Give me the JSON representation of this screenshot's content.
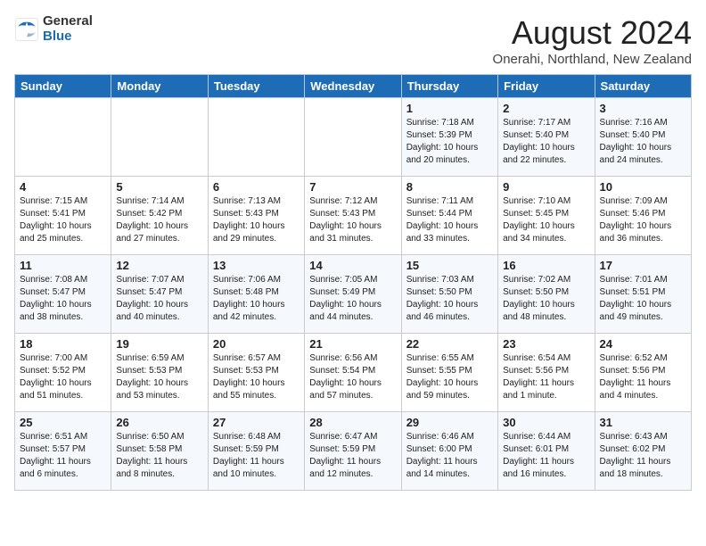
{
  "logo": {
    "general": "General",
    "blue": "Blue"
  },
  "title": "August 2024",
  "subtitle": "Onerahi, Northland, New Zealand",
  "days_header": [
    "Sunday",
    "Monday",
    "Tuesday",
    "Wednesday",
    "Thursday",
    "Friday",
    "Saturday"
  ],
  "weeks": [
    [
      {
        "day": "",
        "info": ""
      },
      {
        "day": "",
        "info": ""
      },
      {
        "day": "",
        "info": ""
      },
      {
        "day": "",
        "info": ""
      },
      {
        "day": "1",
        "info": "Sunrise: 7:18 AM\nSunset: 5:39 PM\nDaylight: 10 hours\nand 20 minutes."
      },
      {
        "day": "2",
        "info": "Sunrise: 7:17 AM\nSunset: 5:40 PM\nDaylight: 10 hours\nand 22 minutes."
      },
      {
        "day": "3",
        "info": "Sunrise: 7:16 AM\nSunset: 5:40 PM\nDaylight: 10 hours\nand 24 minutes."
      }
    ],
    [
      {
        "day": "4",
        "info": "Sunrise: 7:15 AM\nSunset: 5:41 PM\nDaylight: 10 hours\nand 25 minutes."
      },
      {
        "day": "5",
        "info": "Sunrise: 7:14 AM\nSunset: 5:42 PM\nDaylight: 10 hours\nand 27 minutes."
      },
      {
        "day": "6",
        "info": "Sunrise: 7:13 AM\nSunset: 5:43 PM\nDaylight: 10 hours\nand 29 minutes."
      },
      {
        "day": "7",
        "info": "Sunrise: 7:12 AM\nSunset: 5:43 PM\nDaylight: 10 hours\nand 31 minutes."
      },
      {
        "day": "8",
        "info": "Sunrise: 7:11 AM\nSunset: 5:44 PM\nDaylight: 10 hours\nand 33 minutes."
      },
      {
        "day": "9",
        "info": "Sunrise: 7:10 AM\nSunset: 5:45 PM\nDaylight: 10 hours\nand 34 minutes."
      },
      {
        "day": "10",
        "info": "Sunrise: 7:09 AM\nSunset: 5:46 PM\nDaylight: 10 hours\nand 36 minutes."
      }
    ],
    [
      {
        "day": "11",
        "info": "Sunrise: 7:08 AM\nSunset: 5:47 PM\nDaylight: 10 hours\nand 38 minutes."
      },
      {
        "day": "12",
        "info": "Sunrise: 7:07 AM\nSunset: 5:47 PM\nDaylight: 10 hours\nand 40 minutes."
      },
      {
        "day": "13",
        "info": "Sunrise: 7:06 AM\nSunset: 5:48 PM\nDaylight: 10 hours\nand 42 minutes."
      },
      {
        "day": "14",
        "info": "Sunrise: 7:05 AM\nSunset: 5:49 PM\nDaylight: 10 hours\nand 44 minutes."
      },
      {
        "day": "15",
        "info": "Sunrise: 7:03 AM\nSunset: 5:50 PM\nDaylight: 10 hours\nand 46 minutes."
      },
      {
        "day": "16",
        "info": "Sunrise: 7:02 AM\nSunset: 5:50 PM\nDaylight: 10 hours\nand 48 minutes."
      },
      {
        "day": "17",
        "info": "Sunrise: 7:01 AM\nSunset: 5:51 PM\nDaylight: 10 hours\nand 49 minutes."
      }
    ],
    [
      {
        "day": "18",
        "info": "Sunrise: 7:00 AM\nSunset: 5:52 PM\nDaylight: 10 hours\nand 51 minutes."
      },
      {
        "day": "19",
        "info": "Sunrise: 6:59 AM\nSunset: 5:53 PM\nDaylight: 10 hours\nand 53 minutes."
      },
      {
        "day": "20",
        "info": "Sunrise: 6:57 AM\nSunset: 5:53 PM\nDaylight: 10 hours\nand 55 minutes."
      },
      {
        "day": "21",
        "info": "Sunrise: 6:56 AM\nSunset: 5:54 PM\nDaylight: 10 hours\nand 57 minutes."
      },
      {
        "day": "22",
        "info": "Sunrise: 6:55 AM\nSunset: 5:55 PM\nDaylight: 10 hours\nand 59 minutes."
      },
      {
        "day": "23",
        "info": "Sunrise: 6:54 AM\nSunset: 5:56 PM\nDaylight: 11 hours\nand 1 minute."
      },
      {
        "day": "24",
        "info": "Sunrise: 6:52 AM\nSunset: 5:56 PM\nDaylight: 11 hours\nand 4 minutes."
      }
    ],
    [
      {
        "day": "25",
        "info": "Sunrise: 6:51 AM\nSunset: 5:57 PM\nDaylight: 11 hours\nand 6 minutes."
      },
      {
        "day": "26",
        "info": "Sunrise: 6:50 AM\nSunset: 5:58 PM\nDaylight: 11 hours\nand 8 minutes."
      },
      {
        "day": "27",
        "info": "Sunrise: 6:48 AM\nSunset: 5:59 PM\nDaylight: 11 hours\nand 10 minutes."
      },
      {
        "day": "28",
        "info": "Sunrise: 6:47 AM\nSunset: 5:59 PM\nDaylight: 11 hours\nand 12 minutes."
      },
      {
        "day": "29",
        "info": "Sunrise: 6:46 AM\nSunset: 6:00 PM\nDaylight: 11 hours\nand 14 minutes."
      },
      {
        "day": "30",
        "info": "Sunrise: 6:44 AM\nSunset: 6:01 PM\nDaylight: 11 hours\nand 16 minutes."
      },
      {
        "day": "31",
        "info": "Sunrise: 6:43 AM\nSunset: 6:02 PM\nDaylight: 11 hours\nand 18 minutes."
      }
    ]
  ]
}
